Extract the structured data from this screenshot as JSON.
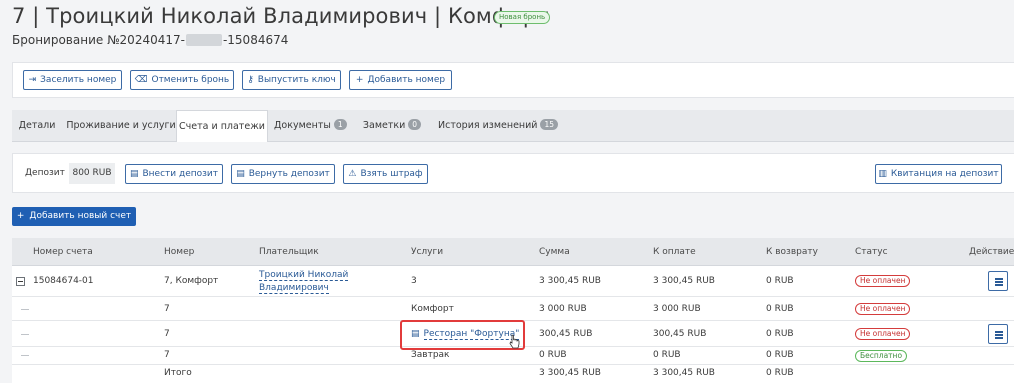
{
  "header": {
    "title": "7 | Троицкий Николай Владимирович | Комфорт",
    "badge": "Новая бронь",
    "booking_prefix": "Бронирование №20240417-",
    "booking_suffix": "-15084674"
  },
  "actions": [
    {
      "label": "Заселить номер",
      "icon": "check-in-icon"
    },
    {
      "label": "Отменить бронь",
      "icon": "cancel-icon"
    },
    {
      "label": "Выпустить ключ",
      "icon": "key-icon"
    },
    {
      "label": "Добавить номер",
      "icon": "plus-icon"
    }
  ],
  "tabs": [
    {
      "label": "Детали"
    },
    {
      "label": "Проживание и услуги"
    },
    {
      "label": "Счета и платежи",
      "active": true
    },
    {
      "label": "Документы",
      "count": "1"
    },
    {
      "label": "Заметки",
      "count": "0"
    },
    {
      "label": "История изменений",
      "count": "15"
    }
  ],
  "deposit": {
    "label": "Депозит",
    "amount": "800 RUB",
    "deposit_in": "Внести депозит",
    "deposit_return": "Вернуть депозит",
    "fine": "Взять штраф",
    "receipt": "Квитанция на депозит"
  },
  "add_invoice": "Добавить новый счет",
  "table": {
    "columns": [
      "Номер счета",
      "Номер",
      "Плательщик",
      "Услуги",
      "Сумма",
      "К оплате",
      "К возврату",
      "Статус",
      "Действие"
    ],
    "invoice": {
      "number": "15084674-01",
      "room": "7, Комфорт",
      "payer_line1": "Троицкий Николай",
      "payer_line2": "Владимирович",
      "services": "3",
      "sum": "3 300,45 RUB",
      "to_pay": "3 300,45 RUB",
      "refund": "0 RUB",
      "status": "Не оплачен"
    },
    "items": [
      {
        "room": "7",
        "service": "Комфорт",
        "sum": "3 000 RUB",
        "to_pay": "3 000 RUB",
        "refund": "0 RUB",
        "status": "Не оплачен"
      },
      {
        "room": "7",
        "service": "Ресторан \"Фортуна\"",
        "sum": "300,45 RUB",
        "to_pay": "300,45 RUB",
        "refund": "0 RUB",
        "status": "Не оплачен"
      },
      {
        "room": "7",
        "service": "Завтрак",
        "sum": "0 RUB",
        "to_pay": "0 RUB",
        "refund": "0 RUB",
        "status": "Бесплатно"
      }
    ],
    "total": {
      "label": "Итого",
      "sum": "3 300,45 RUB",
      "to_pay": "3 300,45 RUB",
      "refund": "0 RUB"
    }
  },
  "colors": {
    "accent": "#1f5fb3",
    "unpaid": "#d43c3c",
    "free": "#5cb85c",
    "highlight": "#e23b3b"
  }
}
